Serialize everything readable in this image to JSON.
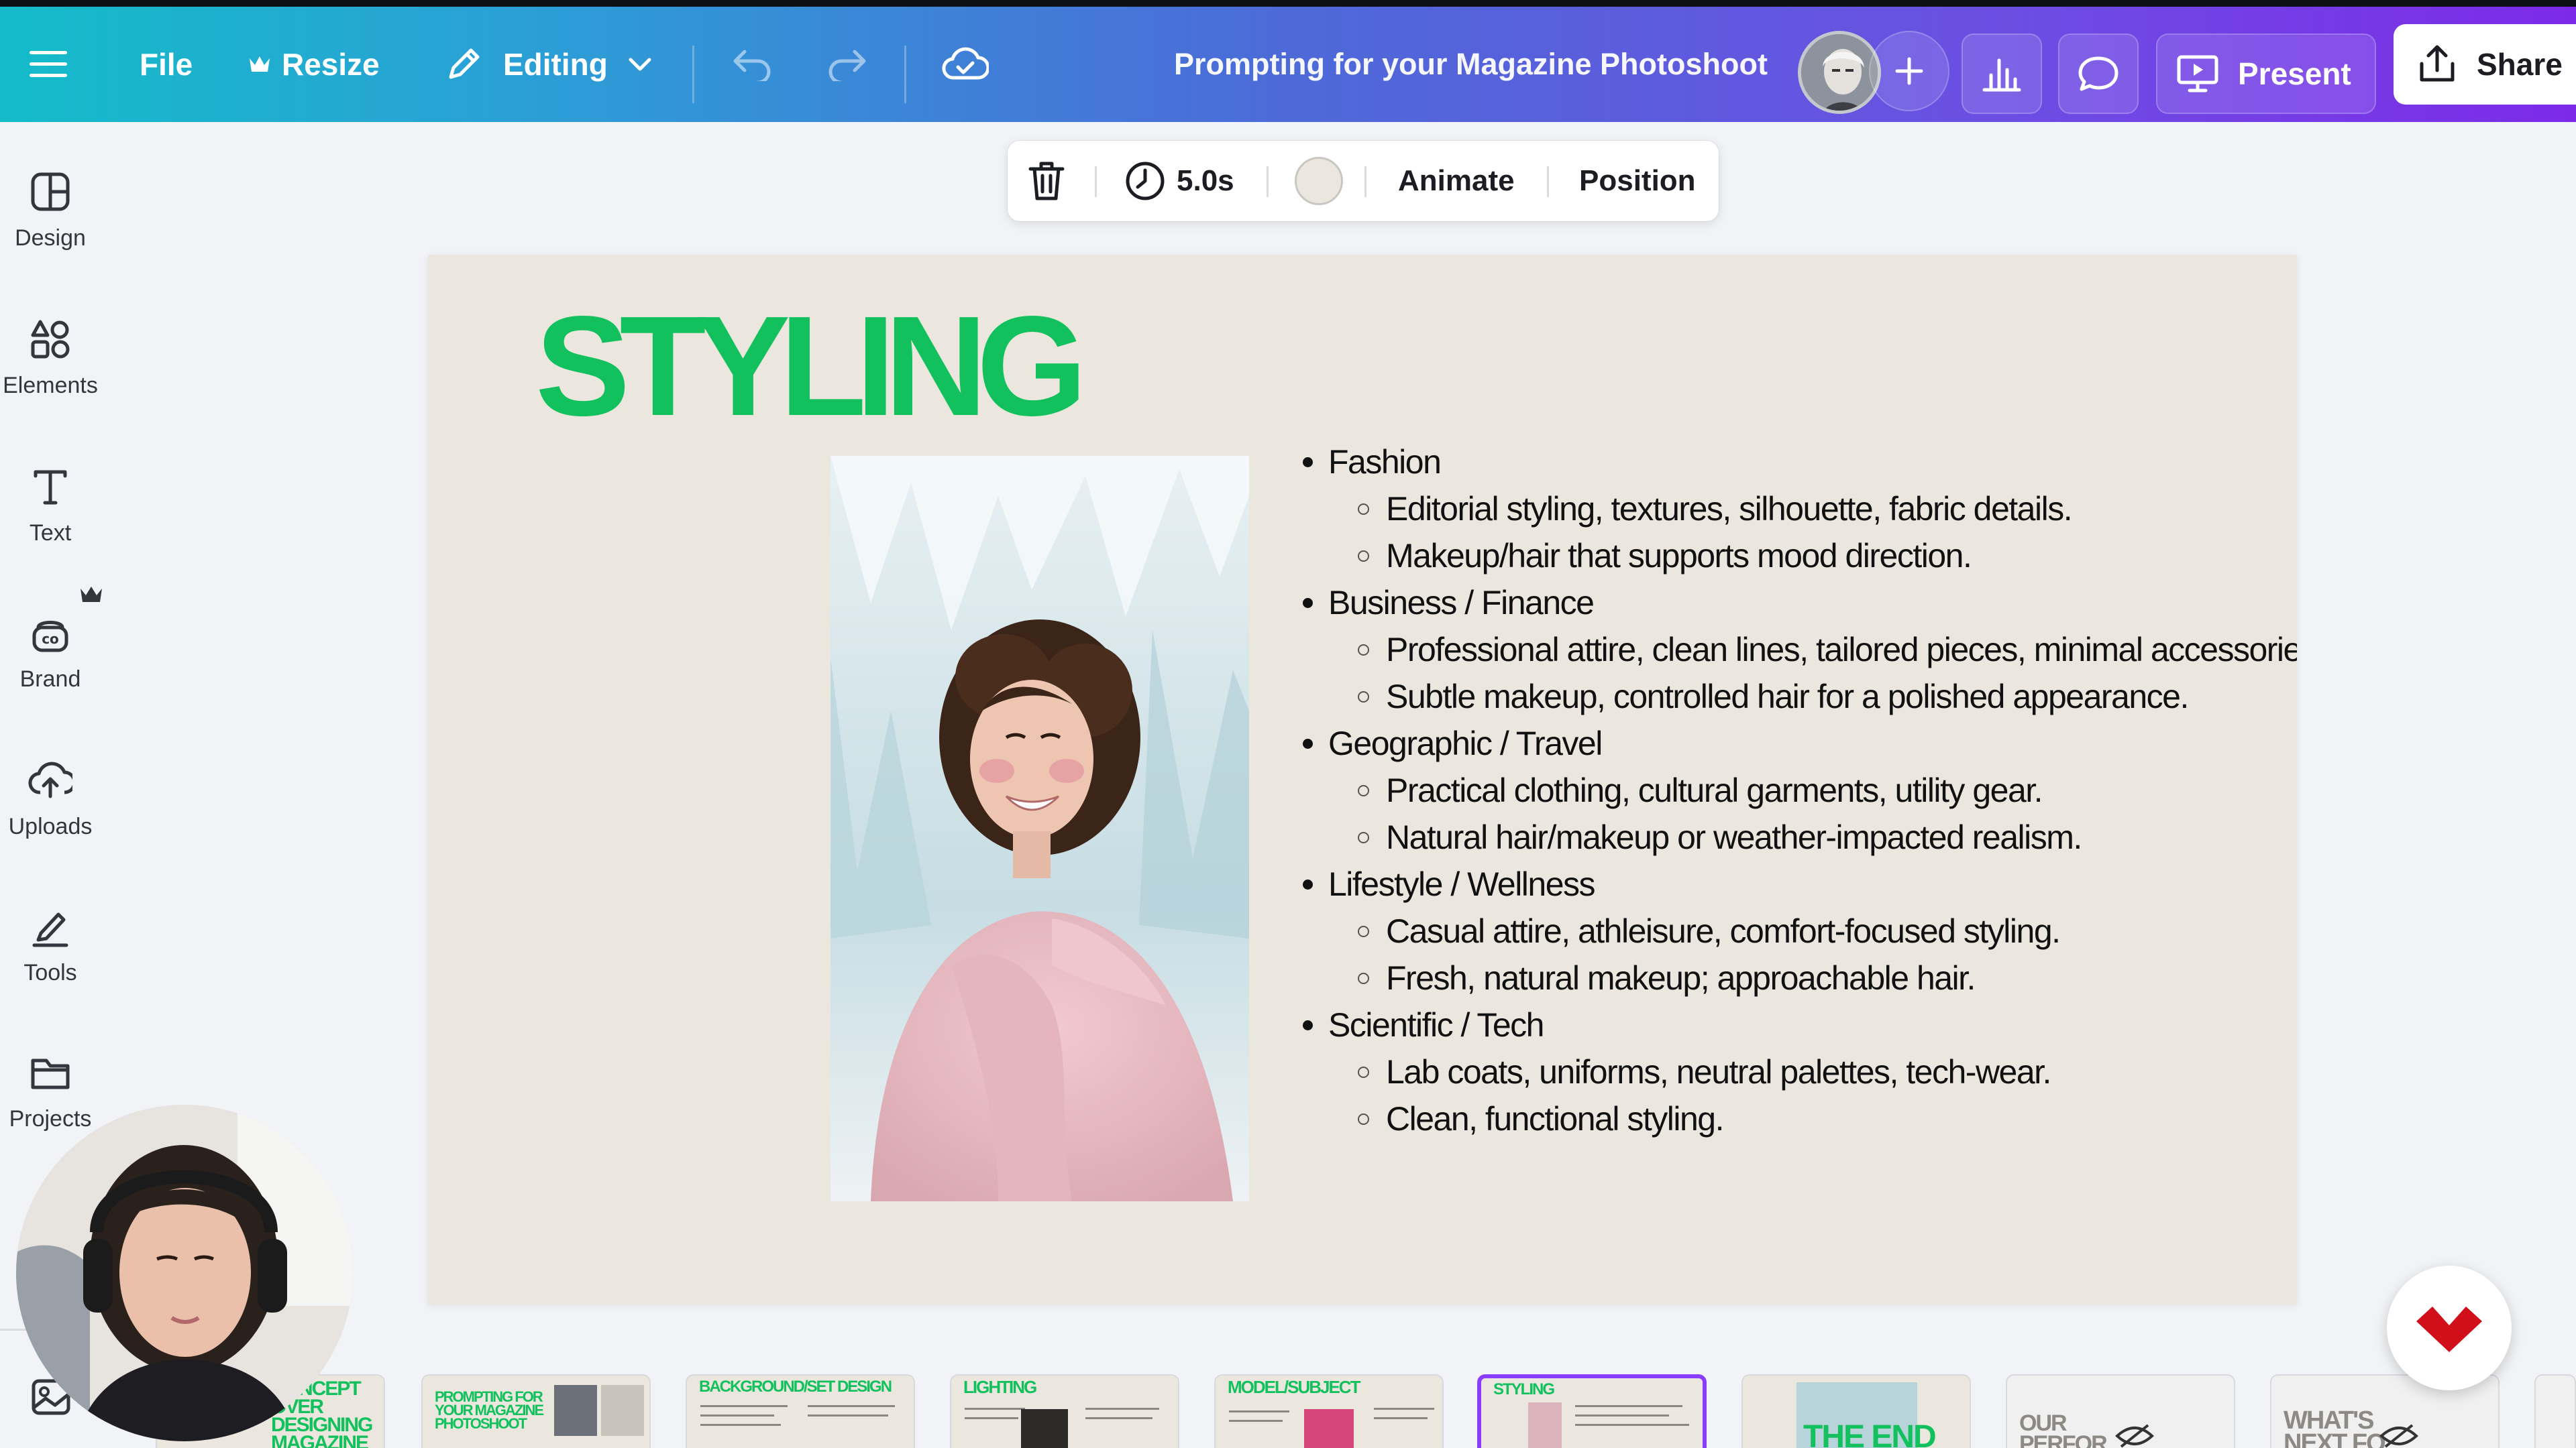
{
  "topbar": {
    "file_label": "File",
    "resize_label": "Resize",
    "editing_label": "Editing",
    "doc_title": "Prompting for your Magazine Photoshoot",
    "present_label": "Present",
    "share_label": "Share"
  },
  "sidebar": {
    "items": [
      {
        "label": "Design",
        "icon": "design-icon"
      },
      {
        "label": "Elements",
        "icon": "elements-icon"
      },
      {
        "label": "Text",
        "icon": "text-icon"
      },
      {
        "label": "Brand",
        "icon": "brand-icon"
      },
      {
        "label": "Uploads",
        "icon": "uploads-icon"
      },
      {
        "label": "Tools",
        "icon": "tools-icon"
      },
      {
        "label": "Projects",
        "icon": "projects-icon"
      }
    ]
  },
  "element_toolbar": {
    "duration": "5.0s",
    "animate_label": "Animate",
    "position_label": "Position"
  },
  "slide": {
    "title": "STYLING",
    "bullets": [
      {
        "text": "Fashion",
        "subs": [
          "Editorial styling, textures, silhouette, fabric details.",
          "Makeup/hair that supports mood direction."
        ]
      },
      {
        "text": "Business / Finance",
        "subs": [
          "Professional attire, clean lines, tailored pieces, minimal accessories.",
          "Subtle makeup, controlled hair for a polished appearance."
        ]
      },
      {
        "text": "Geographic / Travel",
        "subs": [
          "Practical clothing, cultural garments, utility gear.",
          "Natural hair/makeup or weather-impacted realism."
        ]
      },
      {
        "text": "Lifestyle / Wellness",
        "subs": [
          "Casual attire, athleisure, comfort-focused styling.",
          "Fresh, natural makeup; approachable hair."
        ]
      },
      {
        "text": "Scientific / Tech",
        "subs": [
          "Lab coats, uniforms, neutral palettes, tech-wear.",
          "Clean, functional styling."
        ]
      }
    ]
  },
  "thumbnails": [
    {
      "title": "CONCEPT OVER DESIGNING MAGAZINE",
      "style": "green"
    },
    {
      "title": "PROMPTING FOR YOUR MAGAZINE PHOTOSHOOT",
      "style": "green"
    },
    {
      "title": "BACKGROUND/SET DESIGN",
      "style": "green"
    },
    {
      "title": "LIGHTING",
      "style": "green"
    },
    {
      "title": "MODEL/SUBJECT",
      "style": "green"
    },
    {
      "title": "STYLING",
      "style": "green",
      "active": true
    },
    {
      "title": "THE END",
      "style": "green"
    },
    {
      "title": "OUR PERFOR",
      "style": "gray"
    },
    {
      "title": "WHAT'S NEXT FO",
      "style": "gray"
    }
  ],
  "colors": {
    "accent_purple": "#8b3dff",
    "title_green": "#12c15d",
    "slide_bg": "#ece7de"
  }
}
